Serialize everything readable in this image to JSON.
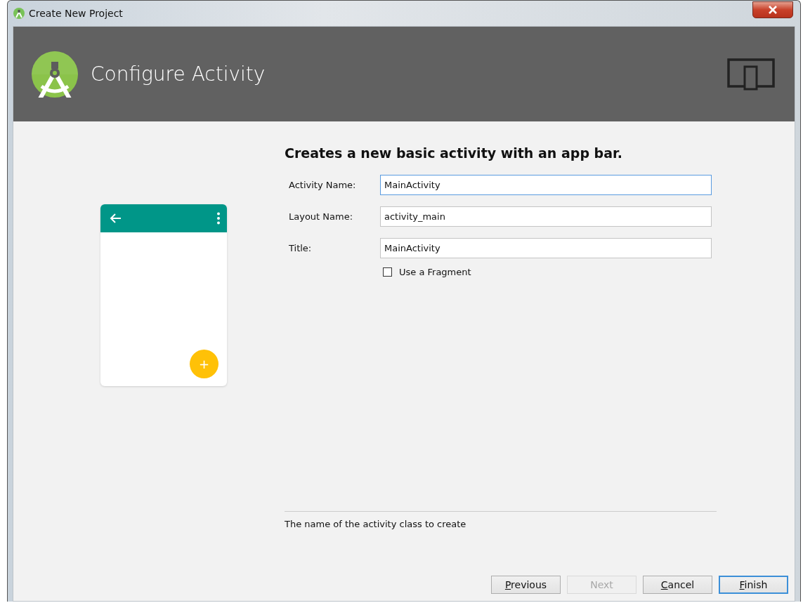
{
  "window": {
    "title": "Create New Project"
  },
  "header": {
    "title": "Configure Activity"
  },
  "description": "Creates a new basic activity with an app bar.",
  "fields": [
    {
      "label": "Activity Name:",
      "value": "MainActivity",
      "focused": true
    },
    {
      "label": "Layout Name:",
      "value": "activity_main",
      "focused": false
    },
    {
      "label": "Title:",
      "value": "MainActivity",
      "focused": false
    }
  ],
  "options": [
    {
      "label": "Use a Fragment",
      "checked": false
    }
  ],
  "help_text": "The name of the activity class to create",
  "preview": {
    "fab_label": "+"
  },
  "buttons": [
    {
      "label": "Previous",
      "disabled": false,
      "default": false,
      "mnemonic": true
    },
    {
      "label": "Next",
      "disabled": true,
      "default": false,
      "mnemonic": false
    },
    {
      "label": "Cancel",
      "disabled": false,
      "default": false,
      "mnemonic": true
    },
    {
      "label": "Finish",
      "disabled": false,
      "default": true,
      "mnemonic": true
    }
  ]
}
